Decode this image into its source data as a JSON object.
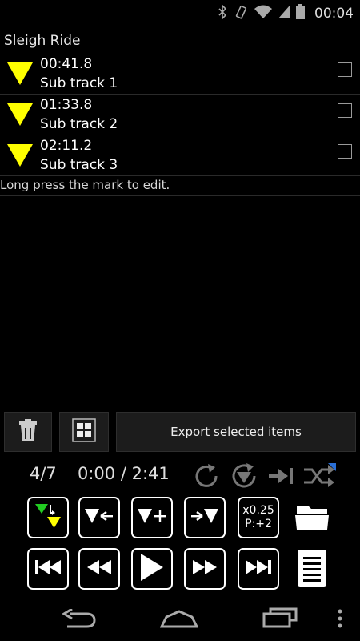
{
  "status_bar": {
    "time": "00:04"
  },
  "title": "Sleigh Ride",
  "marks": [
    {
      "time": "00:41.8",
      "name": "Sub track 1"
    },
    {
      "time": "01:33.8",
      "name": "Sub track 2"
    },
    {
      "time": "02:11.2",
      "name": "Sub track 3"
    }
  ],
  "hint": "Long press the mark to edit.",
  "actions": {
    "export_label": "Export selected items"
  },
  "player": {
    "track_position": "4/7",
    "time_display": "0:00 / 2:41",
    "speed": "x0.25",
    "pitch": "P:+2"
  },
  "colors": {
    "mark_yellow": "#ffff00",
    "mark_green": "#22cc22",
    "accent_blue": "#2a6fd6"
  }
}
